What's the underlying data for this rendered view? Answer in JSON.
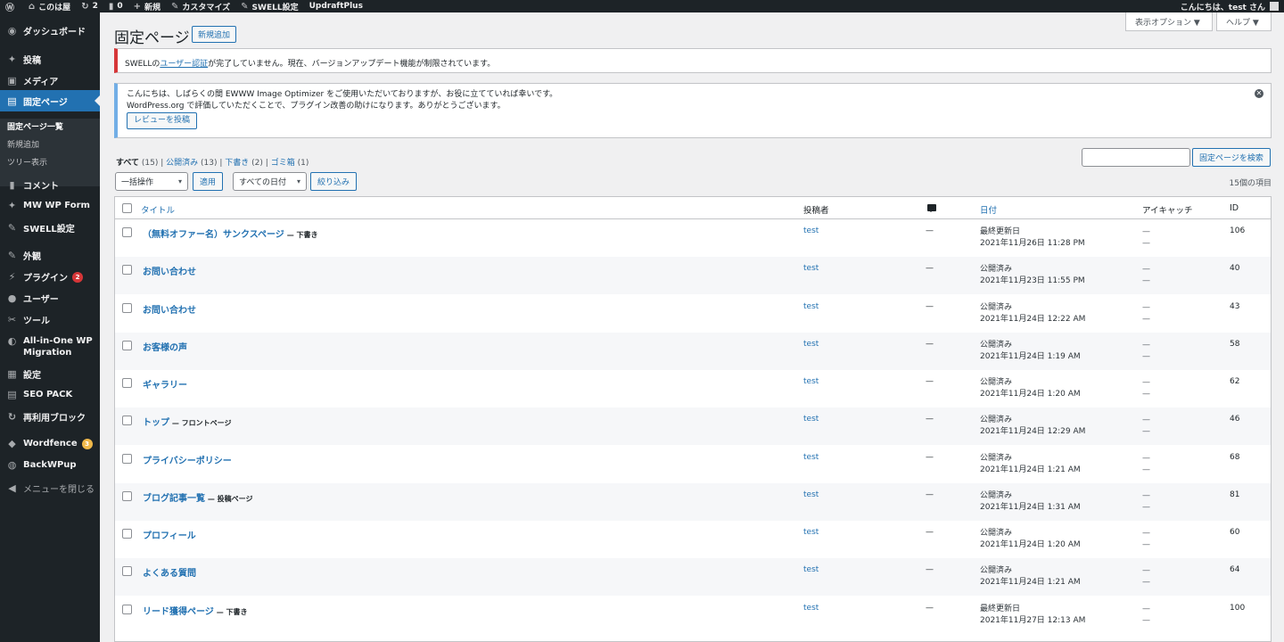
{
  "adminbar": {
    "site_name": "このは屋",
    "updates_count": "2",
    "comments_count": "0",
    "new_label": "新規",
    "customize_label": "カスタマイズ",
    "swell_label": "SWELL設定",
    "updraft_label": "UpdraftPlus",
    "greeting": "こんにちは、test さん"
  },
  "sidebar": {
    "items": [
      {
        "label": "ダッシュボード",
        "icon": "dashboard-icon"
      },
      {
        "label": "投稿",
        "icon": "pin-icon"
      },
      {
        "label": "メディア",
        "icon": "media-icon"
      },
      {
        "label": "固定ページ",
        "icon": "page-icon"
      },
      {
        "label": "コメント",
        "icon": "comment-icon"
      },
      {
        "label": "MW WP Form",
        "icon": "pin-icon"
      },
      {
        "label": "SWELL設定",
        "icon": "swell-icon"
      },
      {
        "label": "外観",
        "icon": "brush-icon"
      },
      {
        "label": "プラグイン",
        "icon": "plugin-icon",
        "badge": "2"
      },
      {
        "label": "ユーザー",
        "icon": "user-icon"
      },
      {
        "label": "ツール",
        "icon": "wrench-icon"
      },
      {
        "label": "All-in-One WP",
        "label2": "Migration",
        "icon": "migration-icon"
      },
      {
        "label": "設定",
        "icon": "settings-icon"
      },
      {
        "label": "SEO PACK",
        "icon": "seo-icon"
      },
      {
        "label": "再利用ブロック",
        "icon": "block-icon"
      },
      {
        "label": "Wordfence",
        "icon": "wordfence-icon",
        "badge": "3"
      },
      {
        "label": "BackWPup",
        "icon": "backwpup-icon"
      },
      {
        "label": "メニューを閉じる",
        "icon": "collapse-icon"
      }
    ],
    "submenu": [
      "固定ページ一覧",
      "新規追加",
      "ツリー表示"
    ]
  },
  "header": {
    "screen_options": "表示オプション ▼",
    "help": "ヘルプ ▼",
    "title": "固定ページ",
    "add_new": "新規追加"
  },
  "notices": {
    "swell_prefix": "SWELLの",
    "swell_link": "ユーザー認証",
    "swell_suffix": "が完了していません。現在、バージョンアップデート機能が制限されています。",
    "ewww_line1": "こんにちは、しばらくの間 EWWW Image Optimizer をご使用いただいておりますが、お役に立てていれば幸いです。",
    "ewww_line2": "WordPress.org で評価していただくことで、プラグイン改善の助けになります。ありがとうございます。",
    "ewww_button": "レビューを投稿"
  },
  "filters": {
    "all": "すべて",
    "all_count": "(15)",
    "published": "公開済み",
    "published_count": "(13)",
    "draft": "下書き",
    "draft_count": "(2)",
    "trash": "ゴミ箱",
    "trash_count": "(1)",
    "search_button": "固定ページを検索",
    "bulk_action": "一括操作",
    "apply": "適用",
    "all_dates": "すべての日付",
    "filter": "絞り込み",
    "items_count": "15個の項目"
  },
  "table": {
    "headers": {
      "title": "タイトル",
      "author": "投稿者",
      "date": "日付",
      "eyecatch": "アイキャッチ",
      "id": "ID"
    },
    "rows": [
      {
        "title": "（無料オファー名）サンクスページ",
        "state": "下書き",
        "author": "test",
        "comments": "—",
        "status": "最終更新日",
        "date": "2021年11月26日 11:28 PM",
        "id": "106"
      },
      {
        "title": "お問い合わせ",
        "state": "",
        "author": "test",
        "comments": "—",
        "status": "公開済み",
        "date": "2021年11月23日 11:55 PM",
        "id": "40"
      },
      {
        "title": "お問い合わせ",
        "state": "",
        "author": "test",
        "comments": "—",
        "status": "公開済み",
        "date": "2021年11月24日 12:22 AM",
        "id": "43"
      },
      {
        "title": "お客様の声",
        "state": "",
        "author": "test",
        "comments": "—",
        "status": "公開済み",
        "date": "2021年11月24日 1:19 AM",
        "id": "58"
      },
      {
        "title": "ギャラリー",
        "state": "",
        "author": "test",
        "comments": "—",
        "status": "公開済み",
        "date": "2021年11月24日 1:20 AM",
        "id": "62"
      },
      {
        "title": "トップ",
        "state": "フロントページ",
        "author": "test",
        "comments": "—",
        "status": "公開済み",
        "date": "2021年11月24日 12:29 AM",
        "id": "46"
      },
      {
        "title": "プライバシーポリシー",
        "state": "",
        "author": "test",
        "comments": "—",
        "status": "公開済み",
        "date": "2021年11月24日 1:21 AM",
        "id": "68"
      },
      {
        "title": "ブログ記事一覧",
        "state": "投稿ページ",
        "author": "test",
        "comments": "—",
        "status": "公開済み",
        "date": "2021年11月24日 1:31 AM",
        "id": "81"
      },
      {
        "title": "プロフィール",
        "state": "",
        "author": "test",
        "comments": "—",
        "status": "公開済み",
        "date": "2021年11月24日 1:20 AM",
        "id": "60"
      },
      {
        "title": "よくある質問",
        "state": "",
        "author": "test",
        "comments": "—",
        "status": "公開済み",
        "date": "2021年11月24日 1:21 AM",
        "id": "64"
      },
      {
        "title": "リード獲得ページ",
        "state": "下書き",
        "author": "test",
        "comments": "—",
        "status": "最終更新日",
        "date": "2021年11月27日 12:13 AM",
        "id": "100"
      }
    ]
  }
}
